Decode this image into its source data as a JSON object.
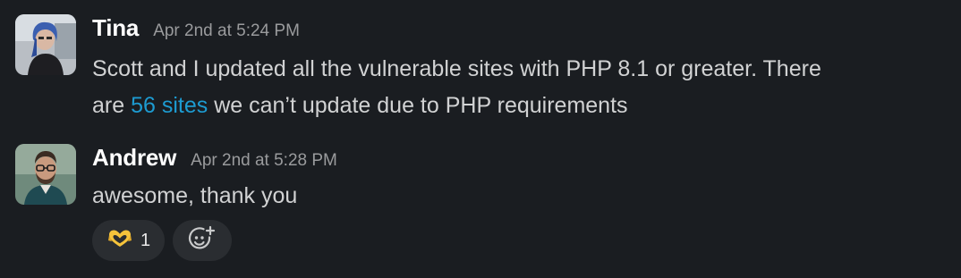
{
  "messages": [
    {
      "author": "Tina",
      "timestamp": "Apr 2nd at 5:24 PM",
      "text_line1": "Scott and I updated all the vulnerable sites with PHP 8.1 or greater. There",
      "text_before_link": "are ",
      "link_text": "56 sites",
      "text_after_link": " we can’t update due to PHP requirements",
      "avatar_icon": "avatar-photo-tina"
    },
    {
      "author": "Andrew",
      "timestamp": "Apr 2nd at 5:28 PM",
      "text": "awesome, thank you",
      "avatar_icon": "avatar-photo-andrew",
      "reactions": [
        {
          "icon": "heart-hands-emoji",
          "count": "1"
        }
      ],
      "add_reaction_icon": "add-reaction-icon"
    }
  ],
  "colors": {
    "background": "#1a1d21",
    "link": "#1d9bd1",
    "author": "#ffffff",
    "timestamp": "#9a9b9d",
    "reaction_bg": "#2a2d31",
    "emoji_yellow": "#f5c33b"
  }
}
